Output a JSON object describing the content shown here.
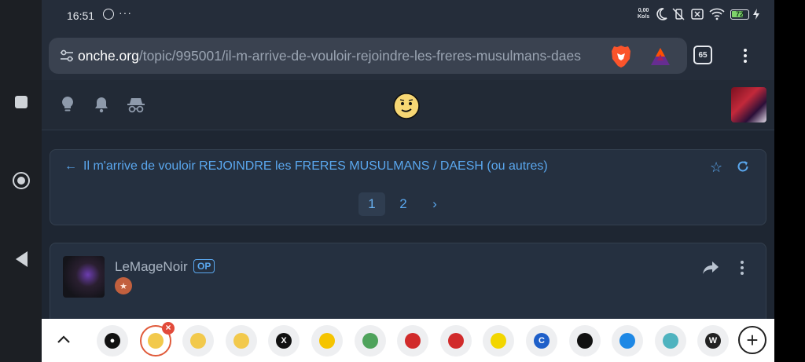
{
  "status_bar": {
    "time": "16:51",
    "more": "···",
    "net_speed_value": "0,00",
    "net_speed_unit": "Ko/s",
    "battery_level": 72
  },
  "browser": {
    "url_host": "onche.org",
    "url_path": "/topic/995001/il-m-arrive-de-vouloir-rejoindre-les-freres-musulmans-daes",
    "tab_count": "65",
    "brave_color": "#fb542b",
    "bat_color": "#9e1f63"
  },
  "site_header": {
    "icons": [
      "lightbulb-icon",
      "bell-icon",
      "incognito-icon"
    ],
    "logo": "onche-smiley-logo"
  },
  "topic": {
    "back_arrow": "←",
    "title": "Il m'arrive de vouloir REJOINDRE les FRERES MUSULMANS / DAESH (ou autres)",
    "star": "☆",
    "pages": [
      "1",
      "2"
    ],
    "current_page": "1",
    "next": "›"
  },
  "post": {
    "author": "LeMageNoir",
    "op_label": "OP",
    "rank_icon": "★"
  },
  "bookmarks": {
    "collapse_icon": "chevron-up-icon",
    "items": [
      {
        "name": "globe-bookmark",
        "color": "#111111",
        "glyph": "●"
      },
      {
        "name": "onche-bookmark-1",
        "color": "#f2c94c",
        "glyph": ""
      },
      {
        "name": "onche-bookmark-2",
        "color": "#f2c94c",
        "glyph": ""
      },
      {
        "name": "onche-bookmark-3",
        "color": "#f2c94c",
        "glyph": ""
      },
      {
        "name": "x-bookmark",
        "color": "#111111",
        "glyph": "X"
      },
      {
        "name": "yellow-dot-bookmark",
        "color": "#f5c400",
        "glyph": ""
      },
      {
        "name": "green-bookmark",
        "color": "#4fa35c",
        "glyph": ""
      },
      {
        "name": "red-shield-bookmark-1",
        "color": "#d12b2b",
        "glyph": ""
      },
      {
        "name": "red-shield-bookmark-2",
        "color": "#d12b2b",
        "glyph": ""
      },
      {
        "name": "yellow-bookmark",
        "color": "#f2d600",
        "glyph": ""
      },
      {
        "name": "c-bookmark",
        "color": "#1e5fc9",
        "glyph": "C"
      },
      {
        "name": "chess-bookmark",
        "color": "#111111",
        "glyph": ""
      },
      {
        "name": "link-bookmark",
        "color": "#1e88e5",
        "glyph": ""
      },
      {
        "name": "cyan-bookmark",
        "color": "#4fb3bf",
        "glyph": ""
      },
      {
        "name": "wikipedia-bookmark",
        "color": "#222222",
        "glyph": "W"
      }
    ],
    "add_label": "+"
  }
}
